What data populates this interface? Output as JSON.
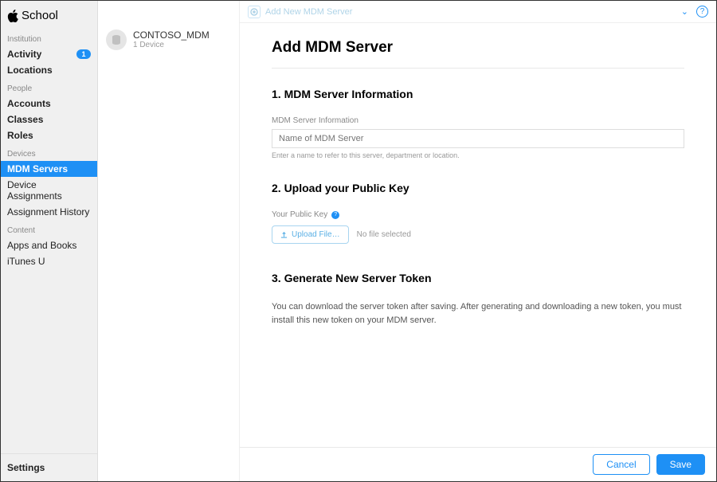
{
  "brand": "School",
  "sidebar": {
    "sections": [
      {
        "header": "Institution",
        "items": [
          {
            "label": "Activity",
            "badge": "1",
            "bold": true
          },
          {
            "label": "Locations",
            "bold": true
          }
        ]
      },
      {
        "header": "People",
        "items": [
          {
            "label": "Accounts",
            "bold": true
          },
          {
            "label": "Classes",
            "bold": true
          },
          {
            "label": "Roles",
            "bold": true
          }
        ]
      },
      {
        "header": "Devices",
        "items": [
          {
            "label": "MDM Servers",
            "active": true
          },
          {
            "label": "Device Assignments"
          },
          {
            "label": "Assignment History"
          }
        ]
      },
      {
        "header": "Content",
        "items": [
          {
            "label": "Apps and Books"
          },
          {
            "label": "iTunes U"
          }
        ]
      }
    ],
    "settings": "Settings"
  },
  "server_list": [
    {
      "name": "CONTOSO_MDM",
      "sub": "1 Device"
    }
  ],
  "topbar": {
    "add_text": "Add New MDM Server"
  },
  "form": {
    "title": "Add MDM Server",
    "step1": {
      "title": "1. MDM Server Information",
      "field_label": "MDM Server Information",
      "placeholder": "Name of MDM Server",
      "hint": "Enter a name to refer to this server, department or location."
    },
    "step2": {
      "title": "2. Upload your Public Key",
      "label": "Your Public Key",
      "upload_btn": "Upload File…",
      "status": "No file selected"
    },
    "step3": {
      "title": "3. Generate New Server Token",
      "text": "You can download the server token after saving. After generating and downloading a new token, you must install this new token on your MDM server."
    }
  },
  "footer": {
    "cancel": "Cancel",
    "save": "Save"
  }
}
